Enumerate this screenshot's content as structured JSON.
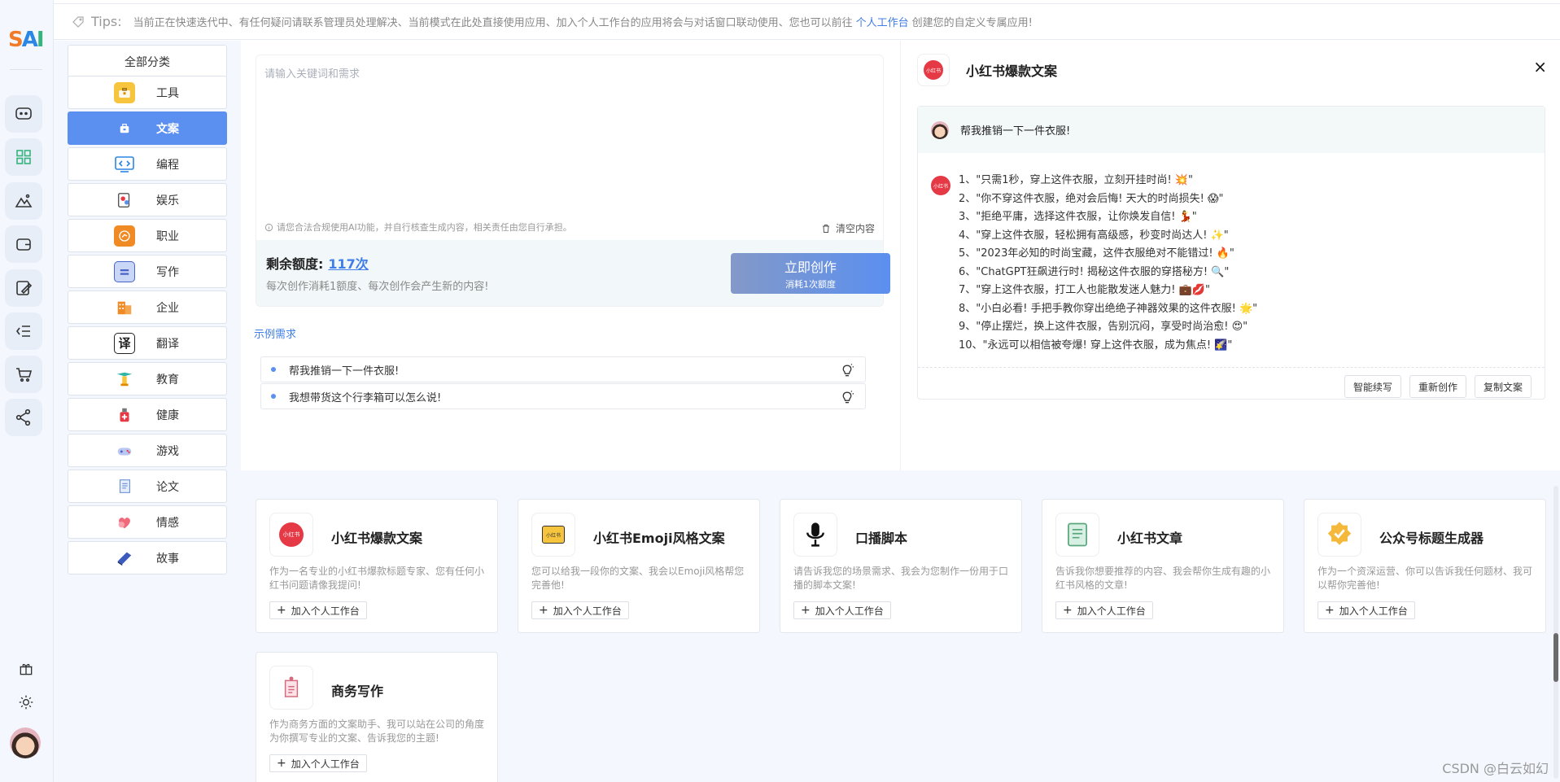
{
  "app": {
    "logo_s": "S",
    "logo_a": "A",
    "logo_i": "I"
  },
  "tips": {
    "label": "Tips:",
    "text_before": "当前正在快速迭代中、有任何疑问请联系管理员处理解决、当前模式在此处直接使用应用、加入个人工作台的应用将会与对话窗口联动使用、您也可以前往",
    "link": "个人工作台",
    "text_after": "创建您的自定义专属应用!"
  },
  "rail": {
    "icons": [
      "chat-icon",
      "apps-grid-icon",
      "image-icon",
      "wallet-icon",
      "edit-image-icon",
      "list-indent-icon",
      "cart-icon",
      "share-icon"
    ],
    "bottom_icons": [
      "gift-icon",
      "sun-icon"
    ],
    "accent": "#3f7de8"
  },
  "categories": [
    {
      "label": "全部分类",
      "icon": ""
    },
    {
      "label": "工具",
      "icon": "toolbox-icon"
    },
    {
      "label": "文案",
      "icon": "copywriting-icon"
    },
    {
      "label": "编程",
      "icon": "code-icon"
    },
    {
      "label": "娱乐",
      "icon": "entertainment-icon"
    },
    {
      "label": "职业",
      "icon": "career-icon"
    },
    {
      "label": "写作",
      "icon": "writing-icon"
    },
    {
      "label": "企业",
      "icon": "enterprise-icon"
    },
    {
      "label": "翻译",
      "icon": "translate-icon"
    },
    {
      "label": "教育",
      "icon": "education-icon"
    },
    {
      "label": "健康",
      "icon": "health-icon"
    },
    {
      "label": "游戏",
      "icon": "game-icon"
    },
    {
      "label": "论文",
      "icon": "paper-icon"
    },
    {
      "label": "情感",
      "icon": "emotion-icon"
    },
    {
      "label": "故事",
      "icon": "story-icon"
    }
  ],
  "editor": {
    "placeholder": "请输入关键词和需求",
    "hint": "请您合法合规使用AI功能，并自行核查生成内容，相关责任由您自行承担。",
    "clear_label": "清空内容"
  },
  "quota": {
    "label": "剩余额度:",
    "value": "117次",
    "desc": "每次创作消耗1额度、每次创作会产生新的内容!",
    "button_main": "立即创作",
    "button_sub": "消耗1次额度"
  },
  "examples": {
    "title": "示例需求",
    "items": [
      "帮我推销一下一件衣服!",
      "我想带货这个行李箱可以怎么说!"
    ]
  },
  "result": {
    "badge_text": "小红书",
    "title": "小红书爆款文案",
    "close": "×",
    "question": "帮我推销一下一件衣服!",
    "answers": [
      "1、\"只需1秒，穿上这件衣服，立刻开挂时尚! 💥\"",
      "2、\"你不穿这件衣服，绝对会后悔! 天大的时尚损失! 😱\"",
      "3、\"拒绝平庸，选择这件衣服，让你焕发自信! 💃\"",
      "4、\"穿上这件衣服，轻松拥有高级感，秒变时尚达人! ✨\"",
      "5、\"2023年必知的时尚宝藏，这件衣服绝对不能错过! 🔥\"",
      "6、\"ChatGPT狂飙进行时! 揭秘这件衣服的穿搭秘方! 🔍\"",
      "7、\"穿上这件衣服，打工人也能散发迷人魅力! 💼💋\"",
      "8、\"小白必看! 手把手教你穿出绝绝子神器效果的这件衣服! 🌟\"",
      "9、\"停止摆烂，换上这件衣服，告别沉闷，享受时尚治愈! 😍\"",
      "10、\"永远可以相信被夸爆! 穿上这件衣服，成为焦点! 🌠\""
    ],
    "actions": [
      "智能续写",
      "重新创作",
      "复制文案"
    ]
  },
  "cards": [
    {
      "title": "小红书爆款文案",
      "desc": "作为一名专业的小红书爆款标题专家、您有任何小红书问题请像我提问!",
      "add": "加入个人工作台",
      "icon": "xiaohongshu-icon"
    },
    {
      "title": "小红书Emoji风格文案",
      "desc": "您可以给我一段你的文案、我会以Emoji风格帮您完善他!",
      "add": "加入个人工作台",
      "icon": "xiaohongshu-emoji-icon"
    },
    {
      "title": "口播脚本",
      "desc": "请告诉我您的场景需求、我会为您制作一份用于口播的脚本文案!",
      "add": "加入个人工作台",
      "icon": "microphone-icon"
    },
    {
      "title": "小红书文章",
      "desc": "告诉我你想要推荐的内容、我会帮你生成有趣的小红书风格的文章!",
      "add": "加入个人工作台",
      "icon": "notebook-icon"
    },
    {
      "title": "公众号标题生成器",
      "desc": "作为一个资深运营、你可以告诉我任何题材、我可以帮你完善他!",
      "add": "加入个人工作台",
      "icon": "verified-badge-icon"
    },
    {
      "title": "商务写作",
      "desc": "作为商务方面的文案助手、我可以站在公司的角度为你撰写专业的文案、告诉我您的主题!",
      "add": "加入个人工作台",
      "icon": "business-writing-icon"
    }
  ],
  "watermark": "CSDN @白云如幻"
}
